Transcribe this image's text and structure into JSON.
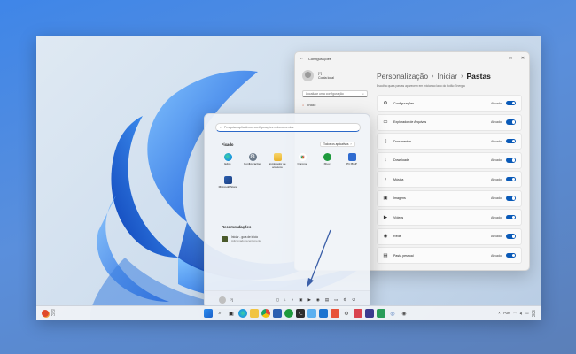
{
  "settings": {
    "window_title": "Configurações",
    "back_glyph": "←",
    "window_controls": [
      "—",
      "□",
      "✕"
    ],
    "user_name": "[?]",
    "user_account": "Conta local",
    "search_placeholder": "Localizar uma configuração",
    "nav_items": [
      {
        "label": "Início",
        "icon": "home-icon"
      }
    ],
    "breadcrumb": [
      "Personalização",
      "Iniciar",
      "Pastas"
    ],
    "breadcrumb_sep": "›",
    "description": "Escolha quais pastas aparecem em Iniciar ao lado do botão Energia",
    "rows": [
      {
        "label": "Configurações",
        "state": "Ativado",
        "icon": "gear-icon",
        "glyph": "⚙"
      },
      {
        "label": "Explorador de Arquivos",
        "state": "Ativado",
        "icon": "folder-icon",
        "glyph": "▭"
      },
      {
        "label": "Documentos",
        "state": "Ativado",
        "icon": "document-icon",
        "glyph": "▯"
      },
      {
        "label": "Downloads",
        "state": "Ativado",
        "icon": "download-icon",
        "glyph": "↓"
      },
      {
        "label": "Música",
        "state": "Ativado",
        "icon": "music-icon",
        "glyph": "♪"
      },
      {
        "label": "Imagens",
        "state": "Ativado",
        "icon": "image-icon",
        "glyph": "▣"
      },
      {
        "label": "Vídeos",
        "state": "Ativado",
        "icon": "video-icon",
        "glyph": "▶"
      },
      {
        "label": "Rede",
        "state": "Ativado",
        "icon": "network-icon",
        "glyph": "◉"
      },
      {
        "label": "Pasta pessoal",
        "state": "Ativado",
        "icon": "user-folder-icon",
        "glyph": "▤"
      }
    ]
  },
  "start": {
    "search_placeholder": "Pesquise aplicativos, configurações e documentos",
    "pinned_heading": "Fixado",
    "all_apps_label": "Todos os aplicativos",
    "pinned_apps": [
      {
        "label": "Edge",
        "icon": "edge-icon",
        "color": "#1a9be0"
      },
      {
        "label": "Configurações",
        "icon": "gear-icon",
        "color": "#6b7a8a"
      },
      {
        "label": "Explorador de arquivos",
        "icon": "folder-icon",
        "color": "#f3c33c"
      },
      {
        "label": "Chrome",
        "icon": "chrome-icon",
        "color": "#e0463b"
      },
      {
        "label": "Xbox",
        "icon": "xbox-icon",
        "color": "#1e9a3d"
      },
      {
        "label": "PC BGP",
        "icon": "pc-icon",
        "color": "#2f6bd0"
      },
      {
        "label": "Microsoft Store",
        "icon": "store-icon",
        "color": "#2b5fb0"
      }
    ],
    "recommended_heading": "Recomendações",
    "recommended": [
      {
        "title": "Iniciar - guia de início",
        "subtitle": "Adicionado recentemente"
      }
    ],
    "user_name": "[?]",
    "footer_icons": [
      "document-icon",
      "download-icon",
      "music-icon",
      "image-icon",
      "video-icon",
      "network-icon",
      "user-folder-icon",
      "folder-icon",
      "gear-icon",
      "power-icon"
    ],
    "footer_glyphs": [
      "▯",
      "↓",
      "♪",
      "▣",
      "▶",
      "◉",
      "▤",
      "▭",
      "⚙",
      "⏻"
    ]
  },
  "taskbar": {
    "weather_temp": "[?]",
    "weather_desc": "[?]",
    "apps": [
      "start-icon",
      "search-icon",
      "task-view-icon",
      "edge-icon",
      "explorer-icon",
      "chrome-icon",
      "store-icon",
      "xbox-icon",
      "terminal-icon",
      "photos-icon",
      "mail-icon",
      "music-icon",
      "settings-icon",
      "snip-icon",
      "vpn-icon",
      "maps-icon",
      "globe-icon",
      "camera-icon"
    ],
    "lang": "POR",
    "time": "[?]",
    "date": "[?]"
  },
  "colors": {
    "accent": "#0a5ab8",
    "wallpaper_bg": "#cfdeee"
  }
}
